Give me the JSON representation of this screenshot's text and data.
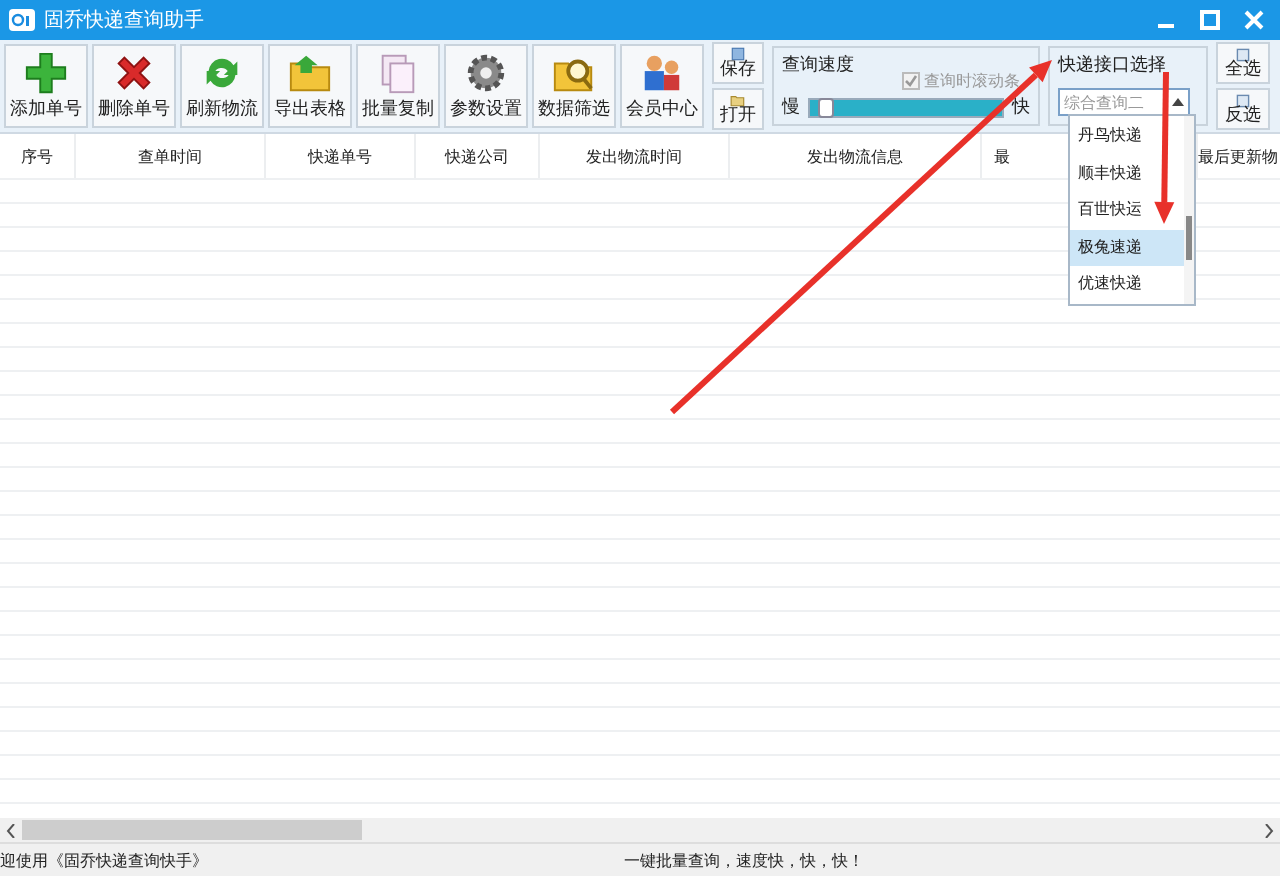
{
  "window": {
    "title": "固乔快递查询助手"
  },
  "toolbar": [
    {
      "label": "添加单号",
      "kind": "add"
    },
    {
      "label": "删除单号",
      "kind": "delete"
    },
    {
      "label": "刷新物流",
      "kind": "refresh"
    },
    {
      "label": "导出表格",
      "kind": "folder"
    },
    {
      "label": "批量复制",
      "kind": "copy"
    },
    {
      "label": "参数设置",
      "kind": "gear"
    },
    {
      "label": "数据筛选",
      "kind": "search"
    },
    {
      "label": "会员中心",
      "kind": "people"
    }
  ],
  "file_buttons": [
    {
      "label": "保存",
      "kind": "save"
    },
    {
      "label": "打开",
      "kind": "open"
    }
  ],
  "speed": {
    "title": "查询速度",
    "checkbox": {
      "label": "查询时滚动条",
      "checked": true,
      "disabled": true
    },
    "slow_label": "慢",
    "fast_label": "快",
    "level": 0.05
  },
  "interface": {
    "title": "快递接口选择",
    "value": "综合查询二",
    "options": [
      {
        "label": "丹鸟快递",
        "selected": false
      },
      {
        "label": "顺丰快递",
        "selected": false
      },
      {
        "label": "百世快运",
        "selected": false
      },
      {
        "label": "极兔速递",
        "selected": true
      },
      {
        "label": "优速快递",
        "selected": false
      }
    ]
  },
  "select_buttons": [
    "全选",
    "反选"
  ],
  "table": {
    "columns": [
      "序号",
      "查单时间",
      "快递单号",
      "快递公司",
      "发出物流时间",
      "发出物流信息",
      "最",
      "最后更新物"
    ]
  },
  "status_bar": {
    "left": "迎使用《固乔快递查询快手》",
    "right": "一键批量查询，速度快，快，快！"
  },
  "annotations": [
    {
      "kind": "arrow"
    },
    {
      "kind": "arrow"
    }
  ]
}
